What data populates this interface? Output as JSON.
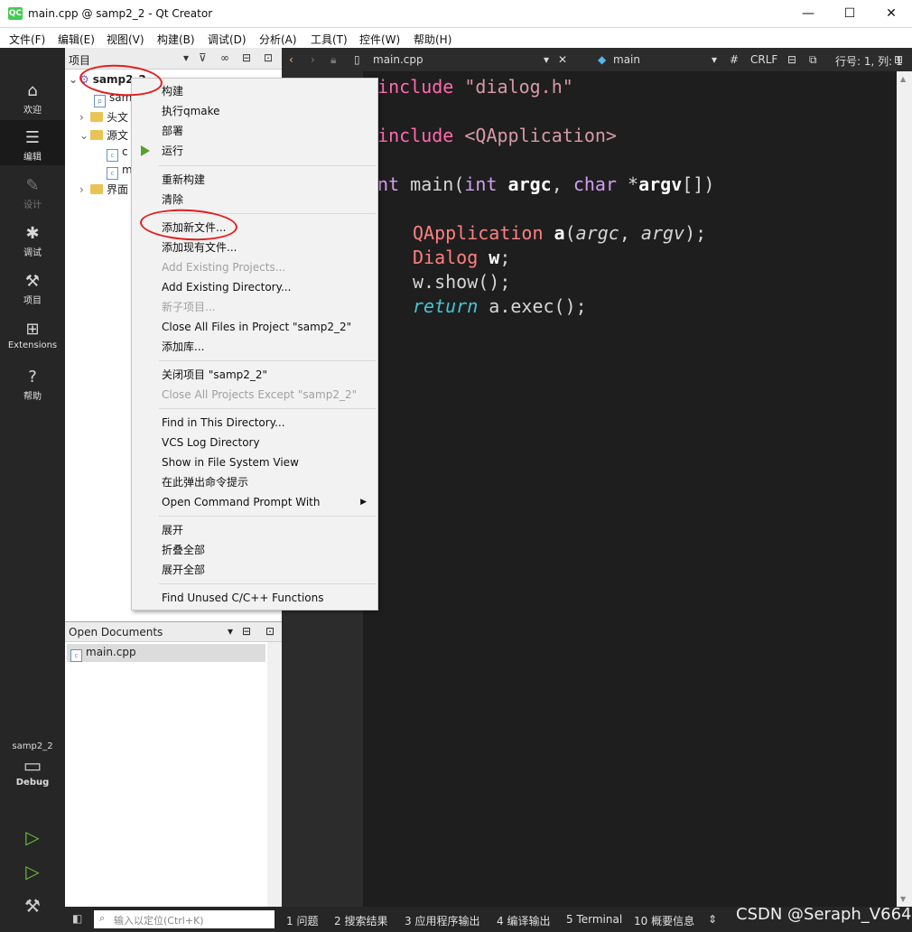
{
  "window": {
    "title": "main.cpp @ samp2_2 - Qt Creator",
    "app_icon_text": "QC",
    "minimize": "—",
    "maximize": "☐",
    "close": "✕"
  },
  "menubar": [
    "文件(F)",
    "编辑(E)",
    "视图(V)",
    "构建(B)",
    "调试(D)",
    "分析(A)",
    "工具(T)",
    "控件(W)",
    "帮助(H)"
  ],
  "modes": [
    {
      "label": "欢迎",
      "icon": "home-icon"
    },
    {
      "label": "编辑",
      "icon": "edit-lines-icon"
    },
    {
      "label": "设计",
      "icon": "pen-icon"
    },
    {
      "label": "调试",
      "icon": "bug-icon"
    },
    {
      "label": "项目",
      "icon": "wrench-icon"
    },
    {
      "label": "Extensions",
      "icon": "extensions-icon"
    },
    {
      "label": "帮助",
      "icon": "help-icon"
    }
  ],
  "kit": {
    "project": "samp2_2",
    "config": "Debug"
  },
  "project_panel": {
    "label": "项目",
    "tree": {
      "root": "samp2_2",
      "items": [
        "sam",
        "头文",
        "源文",
        "c",
        "m",
        "界面"
      ]
    }
  },
  "editor_header": {
    "file": "main.cpp",
    "symbol": "main",
    "hash": "#",
    "line_ending": "CRLF",
    "position": "行号: 1, 列: 1"
  },
  "code": {
    "l1a": "#include ",
    "l1b": "\"dialog.h\"",
    "l2a": "#include ",
    "l2b": "<QApplication>",
    "l3a": "int",
    "l3b": " main(",
    "l3c": "int",
    "l3d": " argc",
    "l3e": ", ",
    "l3f": "char",
    "l3g": " *",
    "l3h": "argv",
    "l3i": "[])",
    "l4a": "QApplication",
    "l4b": " a",
    "l4c": "(",
    "l4d": "argc",
    "l4e": ", ",
    "l4f": "argv",
    "l4g": ");",
    "l5a": "Dialog",
    "l5b": " w",
    "l5c": ";",
    "l6a": "w.show();",
    "l7a": "return",
    "l7b": " a.exec();"
  },
  "open_docs": {
    "label": "Open Documents",
    "files": [
      "main.cpp"
    ]
  },
  "context_menu": {
    "items": [
      {
        "label": "构建",
        "enabled": true
      },
      {
        "label": "执行qmake",
        "enabled": true
      },
      {
        "label": "部署",
        "enabled": true
      },
      {
        "label": "运行",
        "enabled": true
      },
      {
        "label": "重新构建",
        "enabled": true
      },
      {
        "label": "清除",
        "enabled": true
      },
      {
        "label": "添加新文件...",
        "enabled": true
      },
      {
        "label": "添加现有文件...",
        "enabled": true
      },
      {
        "label": "Add Existing Projects...",
        "enabled": false
      },
      {
        "label": "Add Existing Directory...",
        "enabled": true
      },
      {
        "label": "新子项目...",
        "enabled": false
      },
      {
        "label": "Close All Files in Project \"samp2_2\"",
        "enabled": true
      },
      {
        "label": "添加库...",
        "enabled": true
      },
      {
        "label": "关闭项目 \"samp2_2\"",
        "enabled": true
      },
      {
        "label": "Close All Projects Except \"samp2_2\"",
        "enabled": false
      },
      {
        "label": "Find in This Directory...",
        "enabled": true
      },
      {
        "label": "VCS Log Directory",
        "enabled": true
      },
      {
        "label": "Show in File System View",
        "enabled": true
      },
      {
        "label": "在此弹出命令提示",
        "enabled": true
      },
      {
        "label": "Open Command Prompt With",
        "enabled": true
      },
      {
        "label": "展开",
        "enabled": true
      },
      {
        "label": "折叠全部",
        "enabled": true
      },
      {
        "label": "展开全部",
        "enabled": true
      },
      {
        "label": "Find Unused C/C++ Functions",
        "enabled": true
      }
    ]
  },
  "statusbar": {
    "locator_placeholder": "输入以定位(Ctrl+K)",
    "tabs": [
      "1 问题",
      "2 搜索结果",
      "3 应用程序输出",
      "4 编译输出",
      "5 Terminal",
      "10 概要信息"
    ]
  },
  "watermark": "CSDN @Seraph_V664"
}
